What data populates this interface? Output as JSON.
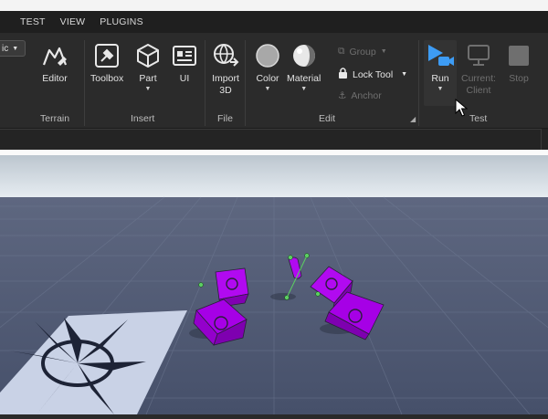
{
  "menu": {
    "items": [
      "TEST",
      "VIEW",
      "PLUGINS"
    ]
  },
  "dropdown": {
    "value": "ic"
  },
  "toolbar": {
    "editor": "Editor",
    "toolbox": "Toolbox",
    "part": "Part",
    "ui": "UI",
    "import_line1": "Import",
    "import_line2": "3D",
    "color": "Color",
    "material": "Material",
    "group": "Group",
    "lock_tool": "Lock Tool",
    "anchor": "Anchor",
    "run": "Run",
    "current_line1": "Current:",
    "current_line2": "Client",
    "stop": "Stop"
  },
  "groups": {
    "terrain": "Terrain",
    "insert": "Insert",
    "file": "File",
    "edit": "Edit",
    "test": "Test"
  },
  "colors": {
    "run_accent": "#3d9cf5",
    "part_selection": "#a600e6",
    "baseplate": "#4e566b",
    "sky": "#dde4ea"
  },
  "icons": [
    "terrain-editor-icon",
    "toolbox-icon",
    "part-cube-icon",
    "ui-icon",
    "import-3d-icon",
    "color-icon",
    "material-icon",
    "group-icon",
    "lock-icon",
    "anchor-icon",
    "run-icon",
    "monitor-icon",
    "stop-icon"
  ]
}
